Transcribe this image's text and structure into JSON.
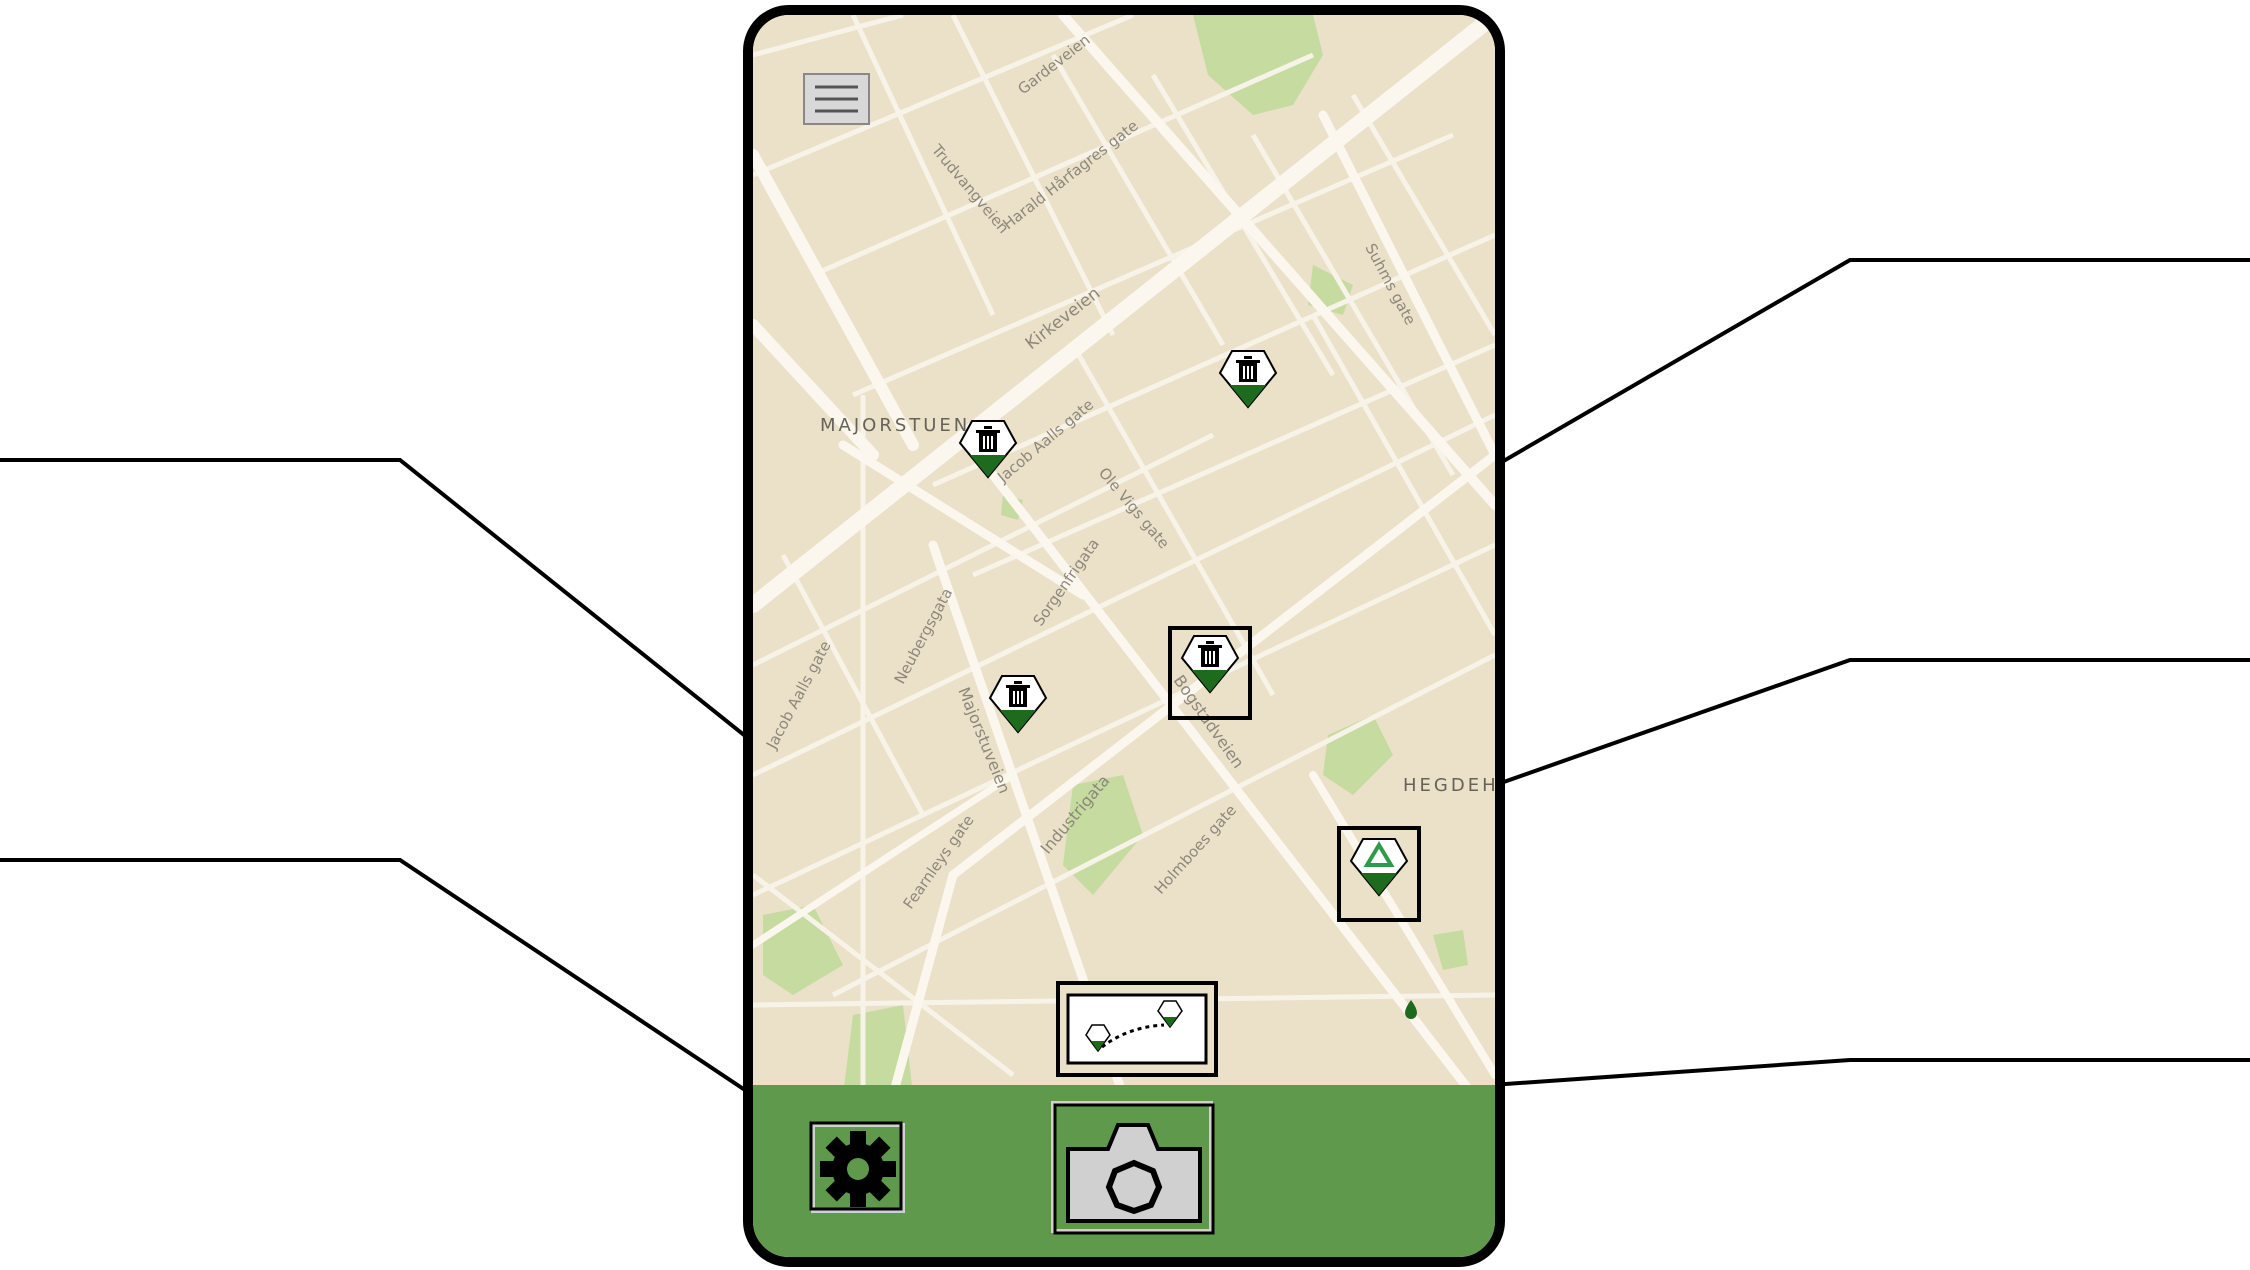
{
  "map": {
    "districts": [
      "MAJORSTUEN",
      "HEGDEH"
    ],
    "streets": [
      "Gardeveien",
      "Trudvangveien",
      "Harald Hårfagres gate",
      "Suhms gate",
      "Kirkeveien",
      "Jacob Aalls gate",
      "Ole Vigs gate",
      "Sorgenfrigata",
      "Neubergsgata",
      "Bogstadveien",
      "Majorstuveien",
      "Industrigata",
      "Fearnleys gate",
      "Holmboes gate"
    ]
  },
  "markers": [
    {
      "id": "marker-1",
      "icon": "trash-bin-icon"
    },
    {
      "id": "marker-2",
      "icon": "trash-bin-icon"
    },
    {
      "id": "marker-3",
      "icon": "trash-bin-icon"
    },
    {
      "id": "marker-4",
      "icon": "trash-bin-icon"
    },
    {
      "id": "marker-5",
      "icon": "recycle-icon"
    }
  ],
  "controls": {
    "menu": "hamburger-menu-icon",
    "route": "route-icon",
    "settings": "gear-icon",
    "camera": "camera-icon"
  },
  "colors": {
    "map_background": "#ebe1c9",
    "roads": "#fbf7ef",
    "parks": "#c5dba0",
    "bottom_bar": "#5e994c",
    "marker_green": "#1e6b1e",
    "callout_lines": "#000000"
  }
}
